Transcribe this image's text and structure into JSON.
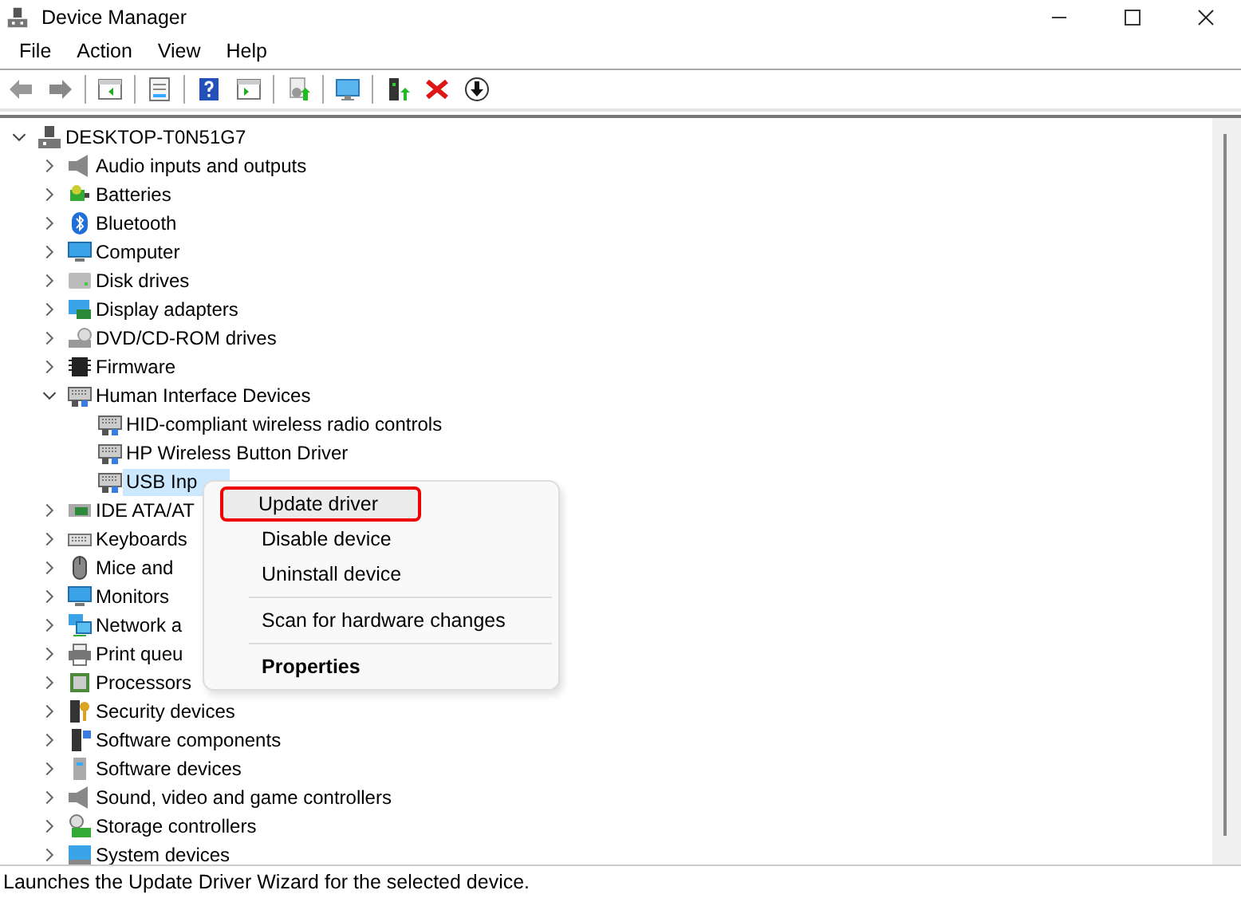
{
  "window": {
    "title": "Device Manager"
  },
  "menu_bar": [
    "File",
    "Action",
    "View",
    "Help"
  ],
  "tree": {
    "label": "DESKTOP-T0N51G7",
    "expanded": true,
    "selected": false,
    "children": [
      {
        "label": "Audio inputs and outputs",
        "expanded": false,
        "selected": false
      },
      {
        "label": "Batteries",
        "expanded": false,
        "selected": false
      },
      {
        "label": "Bluetooth",
        "expanded": false,
        "selected": false
      },
      {
        "label": "Computer",
        "expanded": false,
        "selected": false
      },
      {
        "label": "Disk drives",
        "expanded": false,
        "selected": false
      },
      {
        "label": "Display adapters",
        "expanded": false,
        "selected": false
      },
      {
        "label": "DVD/CD-ROM drives",
        "expanded": false,
        "selected": false
      },
      {
        "label": "Firmware",
        "expanded": false,
        "selected": false
      },
      {
        "label": "Human Interface Devices",
        "expanded": true,
        "selected": false,
        "children": [
          {
            "label": "HID-compliant wireless radio controls",
            "selected": false
          },
          {
            "label": "HP Wireless Button Driver",
            "selected": false
          },
          {
            "label": "USB Inp",
            "selected": true
          }
        ]
      },
      {
        "label": "IDE ATA/AT",
        "expanded": false,
        "selected": false
      },
      {
        "label": "Keyboards",
        "expanded": false,
        "selected": false
      },
      {
        "label": "Mice and",
        "expanded": false,
        "selected": false
      },
      {
        "label": "Monitors",
        "expanded": false,
        "selected": false
      },
      {
        "label": "Network a",
        "expanded": false,
        "selected": false
      },
      {
        "label": "Print queu",
        "expanded": false,
        "selected": false
      },
      {
        "label": "Processors",
        "expanded": false,
        "selected": false
      },
      {
        "label": "Security devices",
        "expanded": false,
        "selected": false
      },
      {
        "label": "Software components",
        "expanded": false,
        "selected": false
      },
      {
        "label": "Software devices",
        "expanded": false,
        "selected": false
      },
      {
        "label": "Sound, video and game controllers",
        "expanded": false,
        "selected": false
      },
      {
        "label": "Storage controllers",
        "expanded": false,
        "selected": false
      },
      {
        "label": "System devices",
        "expanded": false,
        "selected": false
      }
    ]
  },
  "context_menu": {
    "items": [
      {
        "kind": "item",
        "label": "Update driver",
        "selected": true,
        "annotated": true
      },
      {
        "kind": "item",
        "label": "Disable device",
        "selected": false,
        "annotated": false
      },
      {
        "kind": "item",
        "label": "Uninstall device",
        "selected": false,
        "annotated": false
      },
      {
        "kind": "separator"
      },
      {
        "kind": "item",
        "label": "Scan for hardware changes",
        "selected": false,
        "annotated": false
      },
      {
        "kind": "separator"
      },
      {
        "kind": "default",
        "label": "Properties",
        "selected": false,
        "annotated": false
      }
    ]
  },
  "status_bar": "Launches the Update Driver Wizard for the selected device."
}
